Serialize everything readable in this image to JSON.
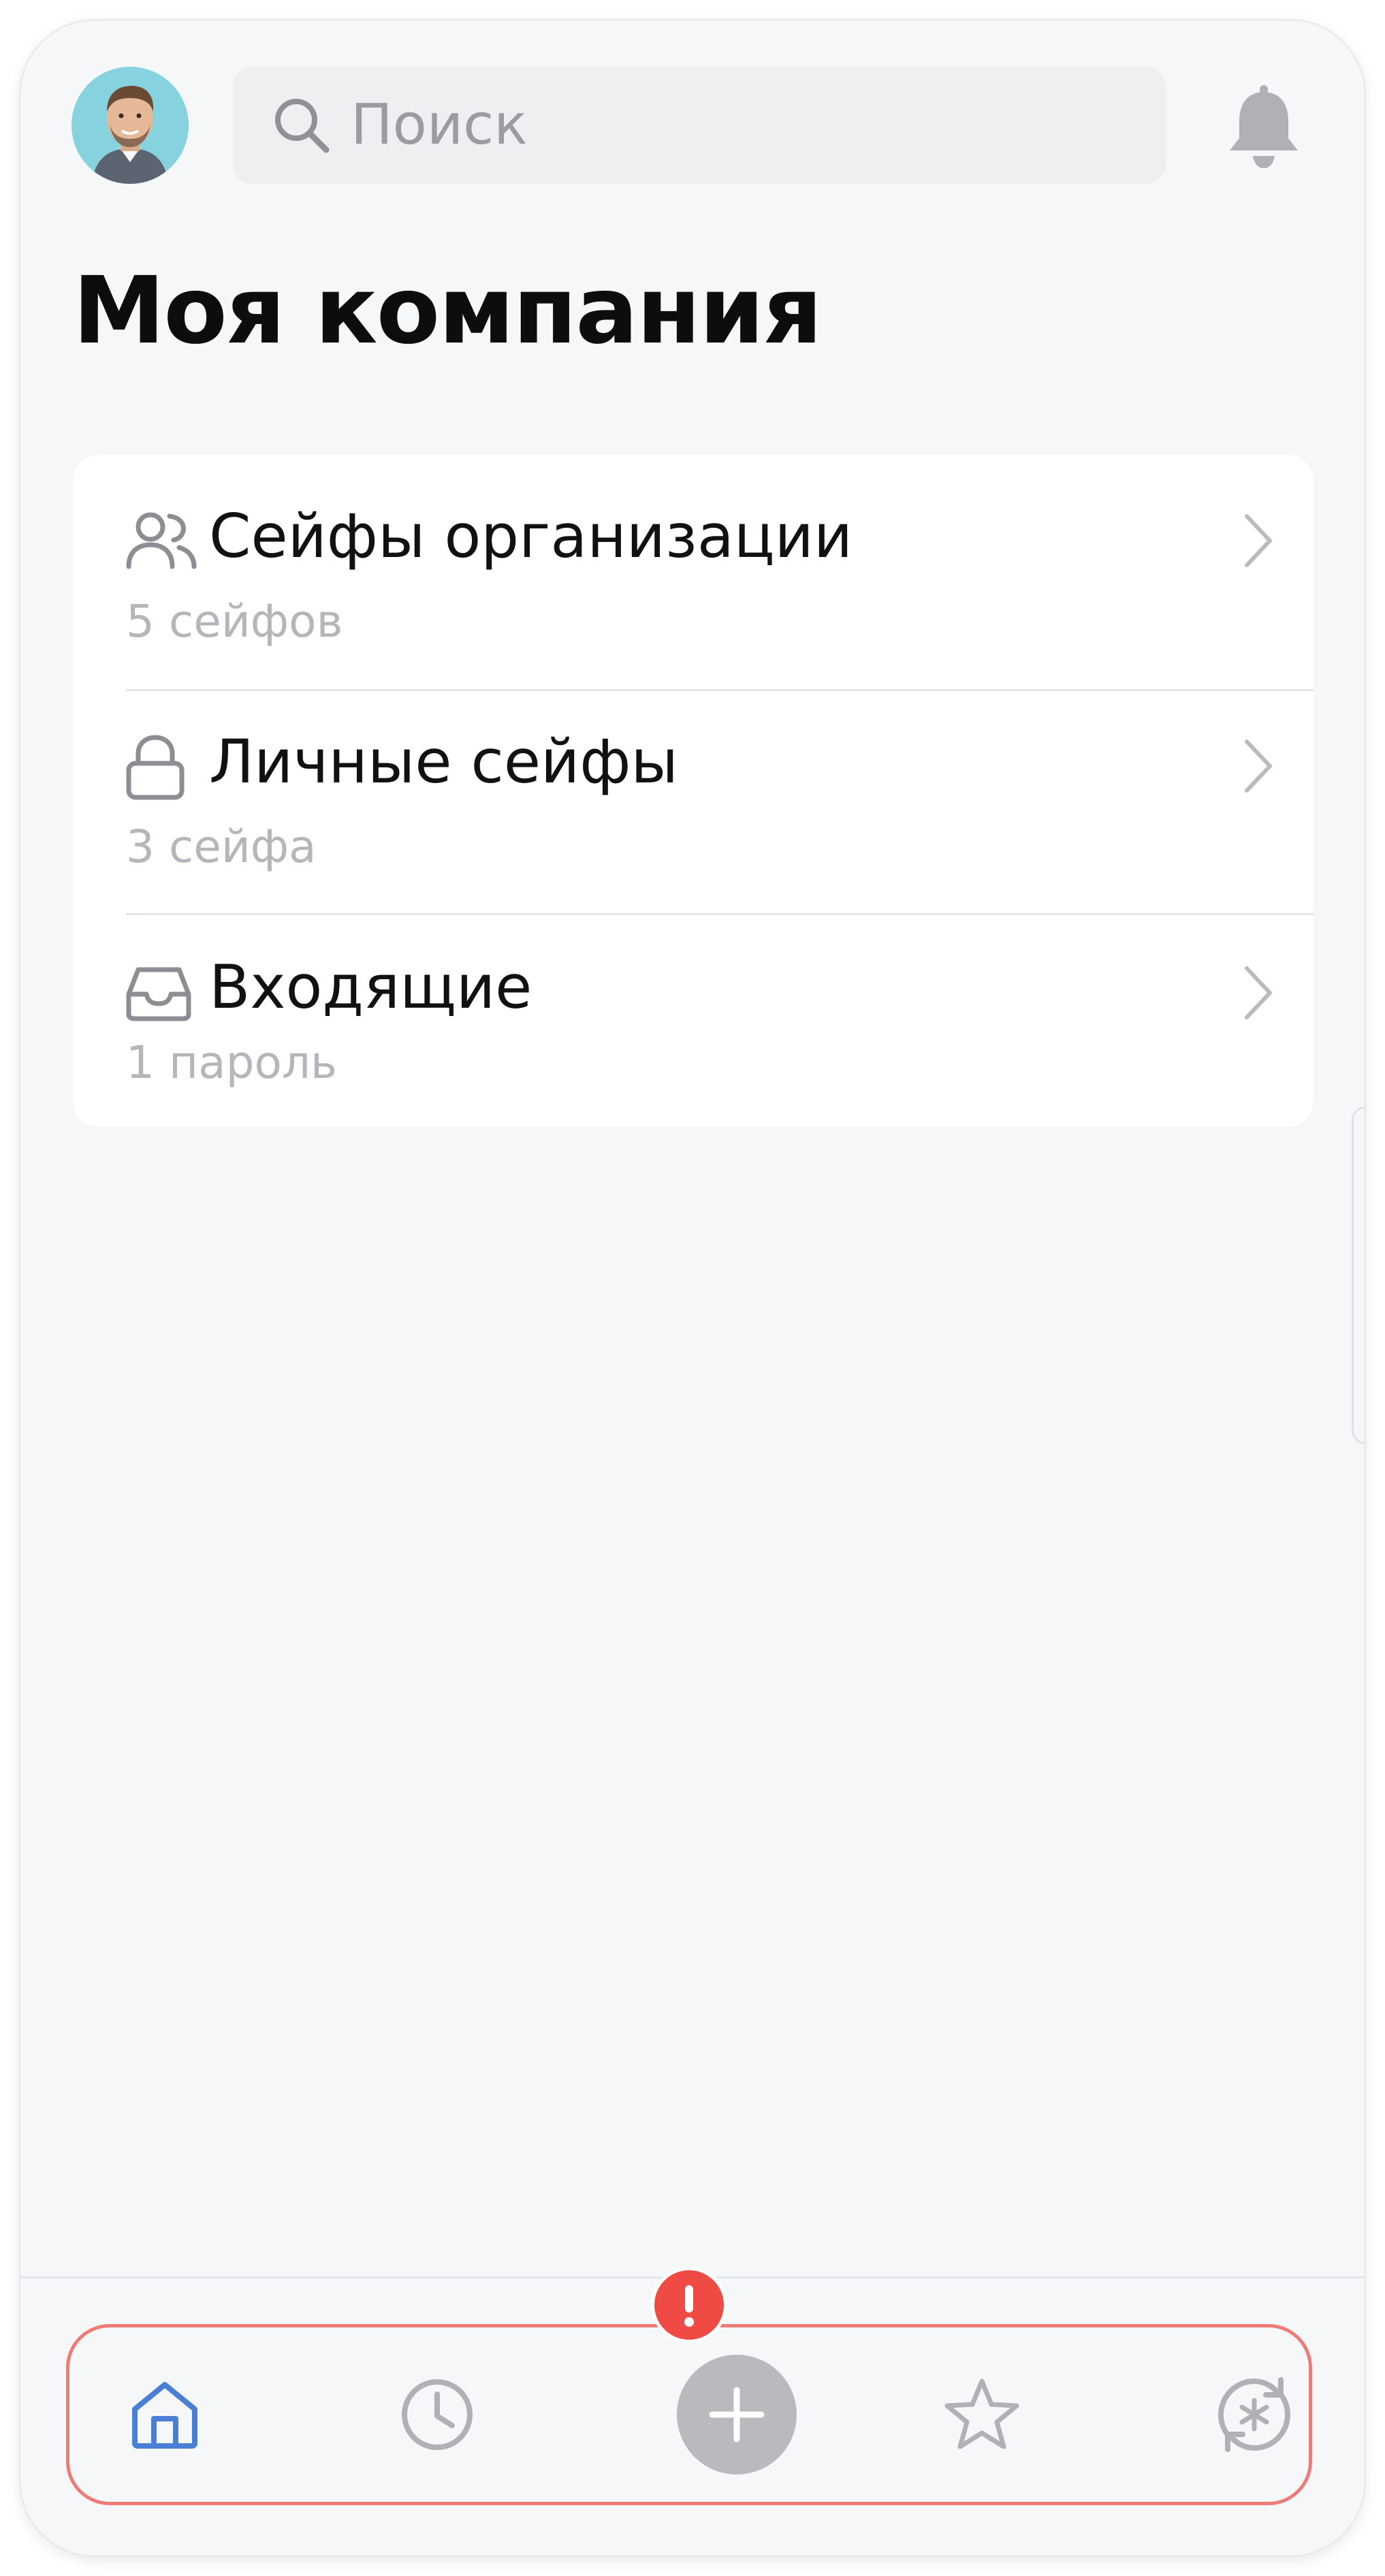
{
  "header": {
    "avatar_icon": "user-avatar-photo",
    "search": {
      "placeholder": "Поиск",
      "icon": "search-icon"
    },
    "notifications_icon": "bell-icon"
  },
  "page_title": "Моя компания",
  "vault_groups": [
    {
      "icon": "users-icon",
      "title": "Сейфы организации",
      "subtitle": "5 сейфов"
    },
    {
      "icon": "lock-icon",
      "title": "Личные сейфы",
      "subtitle": "3 сейфа"
    },
    {
      "icon": "inbox-icon",
      "title": "Входящие",
      "subtitle": "1 пароль"
    }
  ],
  "tabbar": {
    "tabs": [
      {
        "name": "home",
        "icon": "home-icon",
        "active": true
      },
      {
        "name": "recent",
        "icon": "clock-icon",
        "active": false
      },
      {
        "name": "add",
        "icon": "plus-icon",
        "active": false
      },
      {
        "name": "favorites",
        "icon": "star-icon",
        "active": false
      },
      {
        "name": "generator",
        "icon": "refresh-asterisk-icon",
        "active": false
      }
    ],
    "alert_badge": "!"
  },
  "colors": {
    "background": "#f6f7f9",
    "card": "#ffffff",
    "accent_active": "#4a7fd6",
    "icon_inactive": "#b0b1b5",
    "alert": "#f04a45",
    "tabbar_border": "#ee7b76"
  }
}
